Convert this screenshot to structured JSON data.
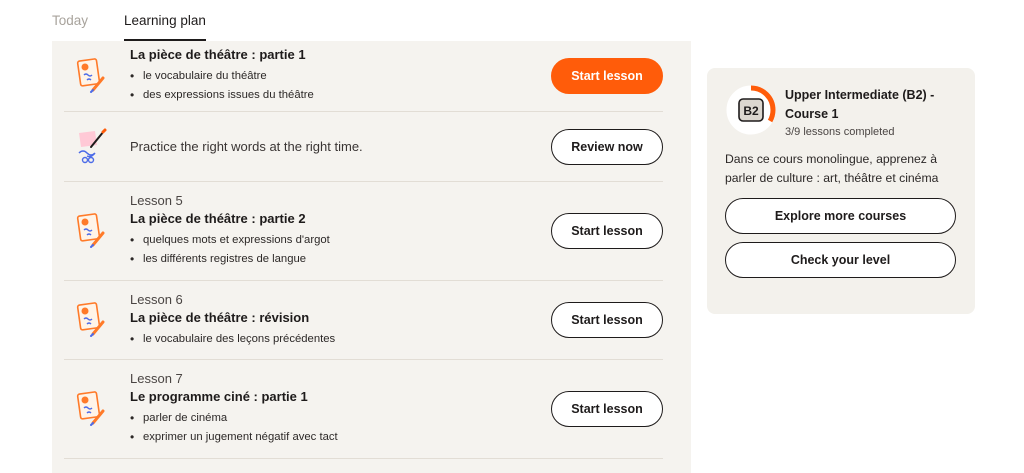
{
  "tabs": [
    {
      "label": "Today",
      "active": false
    },
    {
      "label": "Learning plan",
      "active": true
    }
  ],
  "lessons": [
    {
      "number": "",
      "title": "La pièce de théâtre : partie 1",
      "bullets": [
        "le vocabulaire du théâtre",
        "des expressions issues du théâtre"
      ],
      "button": "Start lesson",
      "primary": true,
      "icon": "lesson-card-icon"
    },
    {
      "practice_text": "Practice the right words at the right time.",
      "button": "Review now",
      "icon": "review-hand-icon"
    },
    {
      "number": "Lesson 5",
      "title": "La pièce de théâtre : partie 2",
      "bullets": [
        "quelques mots et expressions d'argot",
        "les différents registres de langue"
      ],
      "button": "Start lesson",
      "icon": "lesson-card-icon"
    },
    {
      "number": "Lesson 6",
      "title": "La pièce de théâtre : révision",
      "bullets": [
        "le vocabulaire des leçons précédentes"
      ],
      "button": "Start lesson",
      "icon": "lesson-card-icon"
    },
    {
      "number": "Lesson 7",
      "title": "Le programme ciné : partie 1",
      "bullets": [
        "parler de cinéma",
        "exprimer un jugement négatif avec tact"
      ],
      "button": "Start lesson",
      "icon": "lesson-card-icon"
    }
  ],
  "course": {
    "badge": "B2",
    "title": "Upper Intermediate (B2) - Course 1",
    "progress_text": "3/9 lessons completed",
    "progress_fraction": 0.333,
    "description": "Dans ce cours monolingue, apprenez à parler de culture : art, théâtre et cinéma",
    "explore_label": "Explore more courses",
    "level_label": "Check your level"
  },
  "colors": {
    "accent": "#ff5c0a",
    "panel_bg": "#f5f3ef",
    "text": "#1e1b1b"
  }
}
